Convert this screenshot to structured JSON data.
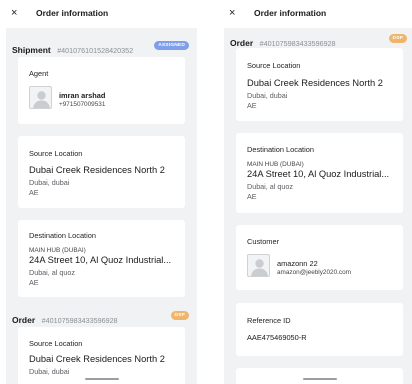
{
  "left": {
    "title": "Order information",
    "close_icon": "×",
    "shipment": {
      "label": "Shipment",
      "id": "#401076101528420352",
      "badge": "ASSIGNED"
    },
    "agent": {
      "title": "Agent",
      "name": "imran arshad",
      "phone": "+971507009531"
    },
    "source": {
      "title": "Source Location",
      "name": "Dubai Creek Residences North 2",
      "city": "Dubai, dubai",
      "country": "AE"
    },
    "destination": {
      "title": "Destination Location",
      "hub": "MAIN HUB (DUBAI)",
      "address": "24A Street 10, Al Quoz Industrial...",
      "city": "Dubai, al quoz",
      "country": "AE"
    },
    "order": {
      "label": "Order",
      "id": "#401075983433596928",
      "badge": "DSP"
    },
    "order_source": {
      "title": "Source Location",
      "name": "Dubai Creek Residences North 2",
      "city": "Dubai, dubai"
    }
  },
  "right": {
    "title": "Order information",
    "close_icon": "×",
    "order": {
      "label": "Order",
      "id": "#401075983433596928",
      "badge": "DSP"
    },
    "source": {
      "title": "Source Location",
      "name": "Dubai Creek Residences North 2",
      "city": "Dubai, dubai",
      "country": "AE"
    },
    "destination": {
      "title": "Destination Location",
      "hub": "MAIN HUB (DUBAI)",
      "address": "24A Street 10, Al Quoz Industrial...",
      "city": "Dubai, al quoz",
      "country": "AE"
    },
    "customer": {
      "title": "Customer",
      "name": "amazonn 22",
      "email": "amazon@jeebly2020.com"
    },
    "reference": {
      "title": "Reference ID",
      "value": "AAE475469050-R"
    }
  },
  "colors": {
    "assigned_badge": "#7fa0e8",
    "dsp_badge": "#f0b56a",
    "background": "#f1f2f4",
    "card": "#ffffff"
  }
}
